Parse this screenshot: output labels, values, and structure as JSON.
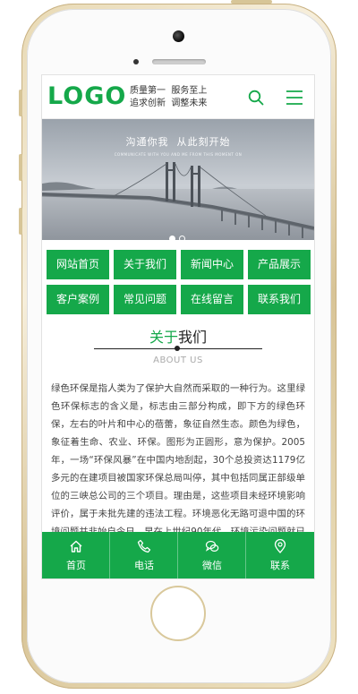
{
  "header": {
    "logo_text": "LOGO",
    "slogan_line1": "质量第一  服务至上",
    "slogan_line2": "追求创新  调整未来"
  },
  "banner": {
    "title": "沟通你我  从此刻开始",
    "subtitle": "COMMUNICATE WITH YOU AND ME FROM THIS MOMENT ON",
    "slide_count": 2,
    "active_slide": 1
  },
  "nav": {
    "items": [
      {
        "label": "网站首页"
      },
      {
        "label": "关于我们"
      },
      {
        "label": "新闻中心"
      },
      {
        "label": "产品展示"
      },
      {
        "label": "客户案例"
      },
      {
        "label": "常见问题"
      },
      {
        "label": "在线留言"
      },
      {
        "label": "联系我们"
      }
    ]
  },
  "about": {
    "title_highlight": "关于",
    "title_rest": "我们",
    "title_en": "ABOUT US",
    "body": "绿色环保是指人类为了保护大自然而采取的一种行为。这里绿色环保标志的含义是，标志由三部分构成，即下方的绿色环保，左右的叶片和中心的蓓蕾，象征自然生态。颜色为绿色，象征着生命、农业、环保。图形为正圆形，意为保护。2005年，一场“环保风暴”在中国内地刮起，30个总投资达1179亿多元的在建项目被国家环保总局叫停，其中包括同属正部级单位的三峡总公司的三个项目。理由是，这些项目未经环境影响评价，属于未批先建的违法工程。环境恶化无路可退中国的环境问题并非始自今日。早在上世纪90年代，环境污染问题就已非"
  },
  "bottom_bar": {
    "items": [
      {
        "label": "首页",
        "icon": "home-icon"
      },
      {
        "label": "电话",
        "icon": "phone-icon"
      },
      {
        "label": "微信",
        "icon": "wechat-icon"
      },
      {
        "label": "联系",
        "icon": "location-icon"
      }
    ]
  },
  "colors": {
    "accent": "#15a84a",
    "text": "#444444",
    "phone_frame": "#e8d9b4"
  }
}
